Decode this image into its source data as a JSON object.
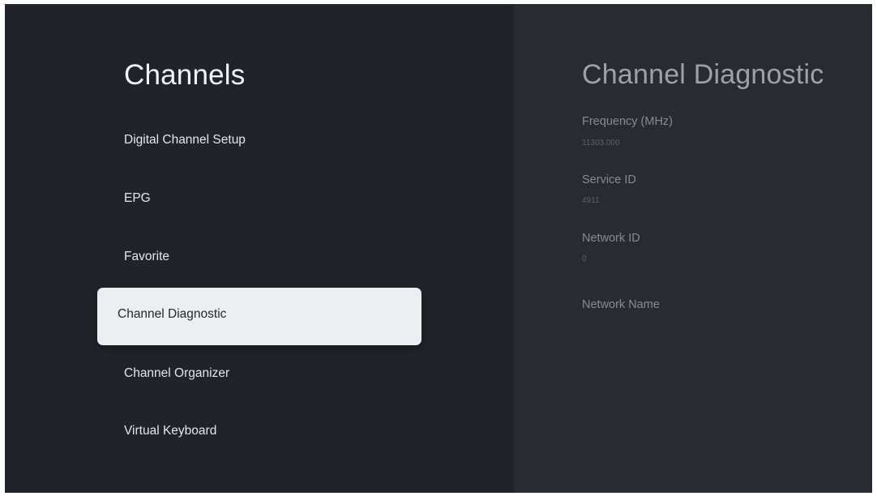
{
  "menu": {
    "title": "Channels",
    "items": [
      {
        "label": "Digital Channel Setup"
      },
      {
        "label": "EPG"
      },
      {
        "label": "Favorite"
      },
      {
        "label": "Channel Diagnostic",
        "selected": true
      },
      {
        "label": "Channel Organizer"
      },
      {
        "label": "Virtual Keyboard"
      }
    ]
  },
  "detail": {
    "title": "Channel Diagnostic",
    "fields": [
      {
        "label": "Frequency (MHz)",
        "value": "11303.000"
      },
      {
        "label": "Service ID",
        "value": "4911"
      },
      {
        "label": "Network ID",
        "value": "0"
      },
      {
        "label": "Network Name",
        "value": ""
      }
    ]
  },
  "colors": {
    "background": "#21242b",
    "detail_background": "#282b31",
    "selected_item_background": "#eceef1"
  }
}
